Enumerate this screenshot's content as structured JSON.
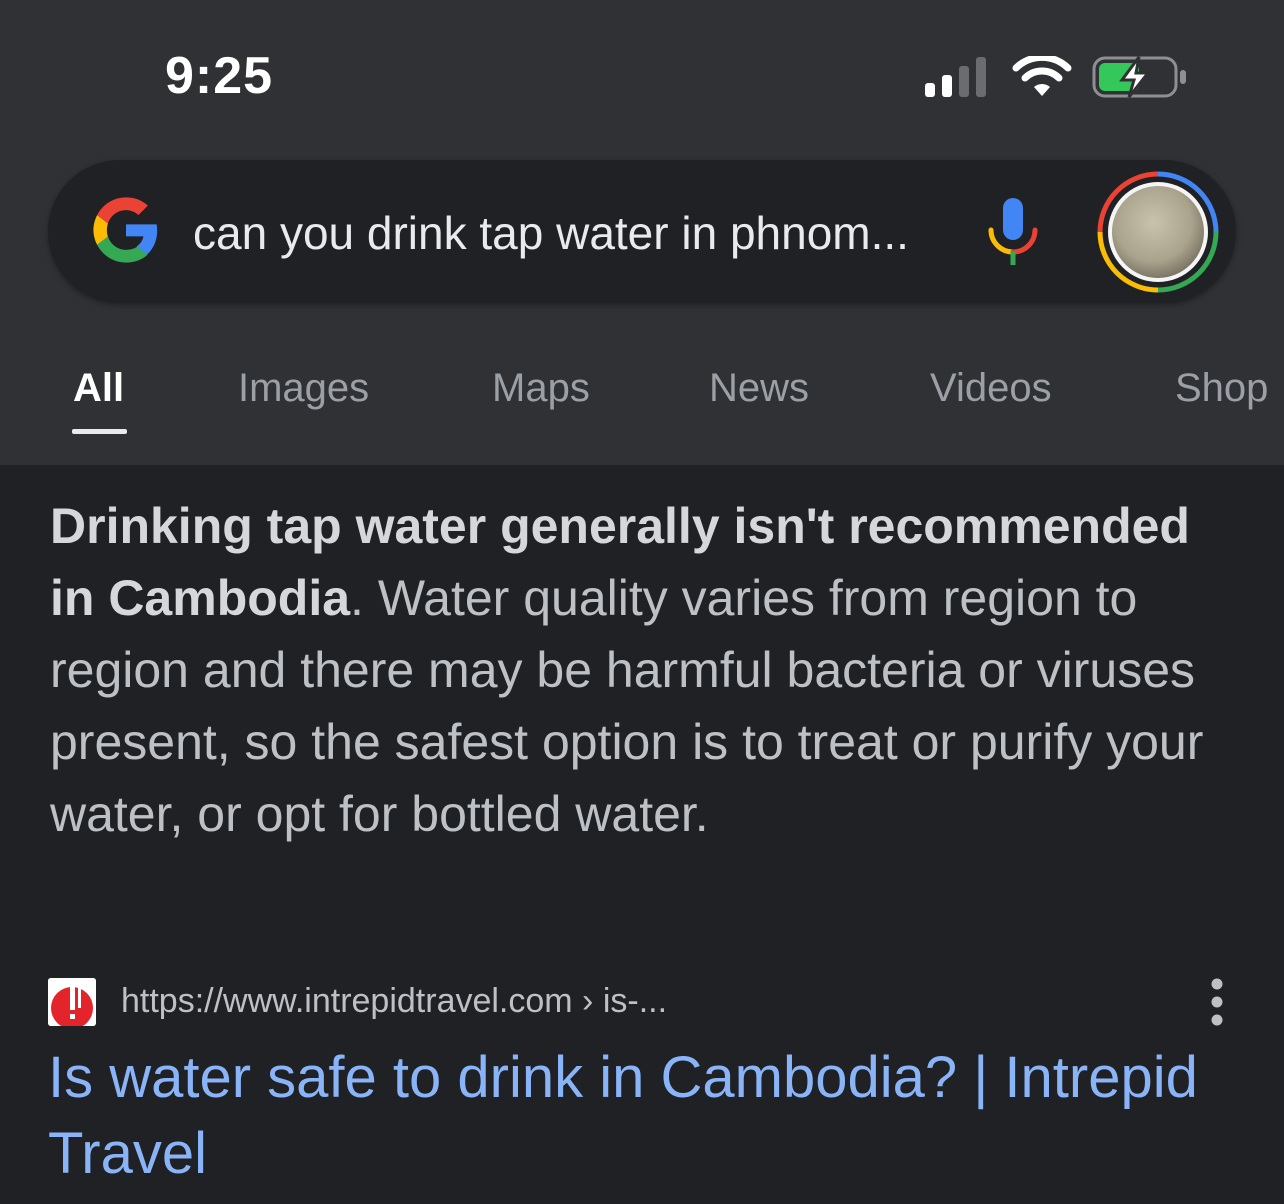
{
  "status_bar": {
    "time": "9:25"
  },
  "search": {
    "query": "can you drink tap water in phnom..."
  },
  "tabs": [
    {
      "label": "All",
      "active": true
    },
    {
      "label": "Images",
      "active": false
    },
    {
      "label": "Maps",
      "active": false
    },
    {
      "label": "News",
      "active": false
    },
    {
      "label": "Videos",
      "active": false
    },
    {
      "label": "Shop",
      "active": false
    }
  ],
  "answer": {
    "bold_text": "Drinking tap water generally isn't recommended in Cambodia",
    "body_text": ". Water quality varies from region to region and there may be harmful bacteria or viruses present, so the safest option is to treat or purify your water, or opt for bottled water."
  },
  "result": {
    "url": "https://www.intrepidtravel.com › is-...",
    "title": "Is water safe to drink in Cambodia? | Intrepid Travel"
  },
  "icons": {
    "signal": "cellular-signal-icon",
    "wifi": "wifi-icon",
    "battery": "battery-charging-icon",
    "google": "google-logo-icon",
    "mic": "microphone-icon",
    "avatar": "account-avatar",
    "favicon": "intrepid-favicon-icon",
    "more": "more-vert-icon"
  },
  "colors": {
    "background": "#202124",
    "header": "#303134",
    "link": "#8ab4f8",
    "battery_green": "#34c759"
  }
}
